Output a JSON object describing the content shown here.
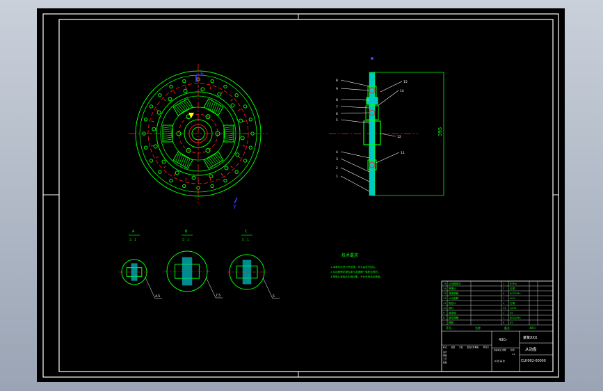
{
  "drawing": {
    "section_views": [
      {
        "letter": "A",
        "scale": "5 : 1",
        "dim": "4.5"
      },
      {
        "letter": "B",
        "scale": "5 : 1",
        "dim": "7.5"
      },
      {
        "letter": "C",
        "scale": "5 : 1",
        "dim": "5"
      }
    ],
    "front_view": {
      "axis_top_label": "L",
      "axis_bottom_label": "Y"
    },
    "side_view": {
      "balloons": [
        "8",
        "9",
        "8",
        "7",
        "6",
        "5",
        "4",
        "3",
        "2",
        "1"
      ],
      "right_balloons": [
        "15",
        "14",
        "12",
        "11"
      ],
      "overall_dim": "395"
    },
    "notes": {
      "title": "技术要求",
      "lines": [
        "1.本零件应进行热处理，淬火后进行回火。",
        "2.从动盘毂花键应能与变速器一轴配合良好。",
        "3.摩擦片铆接应牢固可靠，不允许有松动现象。"
      ]
    },
    "title_block": {
      "company": "某某XXX",
      "title": "从动盘",
      "drawing_no": "CLH002-00000",
      "header_cells": [
        "序号",
        "名称",
        "备注"
      ],
      "sign_cells": [
        "标记",
        "处数",
        "分区",
        "更改文件号",
        "签名",
        "年月日"
      ],
      "role_cells": [
        "设计",
        "审核",
        "工艺",
        "批准"
      ],
      "stage_cells": [
        "阶段标记",
        "重量",
        "比例"
      ],
      "scale_value": "1:1",
      "sheet_text": "共 张 第 张",
      "parts_rows": [
        {
          "no": "15",
          "name": "从动盘钢片",
          "qty": "1",
          "mat": "65Mn"
        },
        {
          "no": "14",
          "name": "摩擦片",
          "qty": "2",
          "mat": "石棉"
        },
        {
          "no": "13",
          "name": "减振弹簧",
          "qty": "6",
          "mat": "60Si2Mn"
        },
        {
          "no": "12",
          "name": "从动盘毂",
          "qty": "1",
          "mat": "40Cr"
        },
        {
          "no": "11",
          "name": "阻尼片",
          "qty": "2",
          "mat": "石棉"
        },
        {
          "no": "10",
          "name": "铆钉",
          "qty": "24",
          "mat": "Q235"
        },
        {
          "no": "9",
          "name": "减振盘",
          "qty": "1",
          "mat": "45"
        },
        {
          "no": "8",
          "name": "碟形弹簧",
          "qty": "1",
          "mat": "60Si2Mn"
        },
        {
          "no": "7",
          "name": "隔套",
          "qty": "8",
          "mat": "45"
        }
      ],
      "material_label": "40Cr"
    }
  }
}
